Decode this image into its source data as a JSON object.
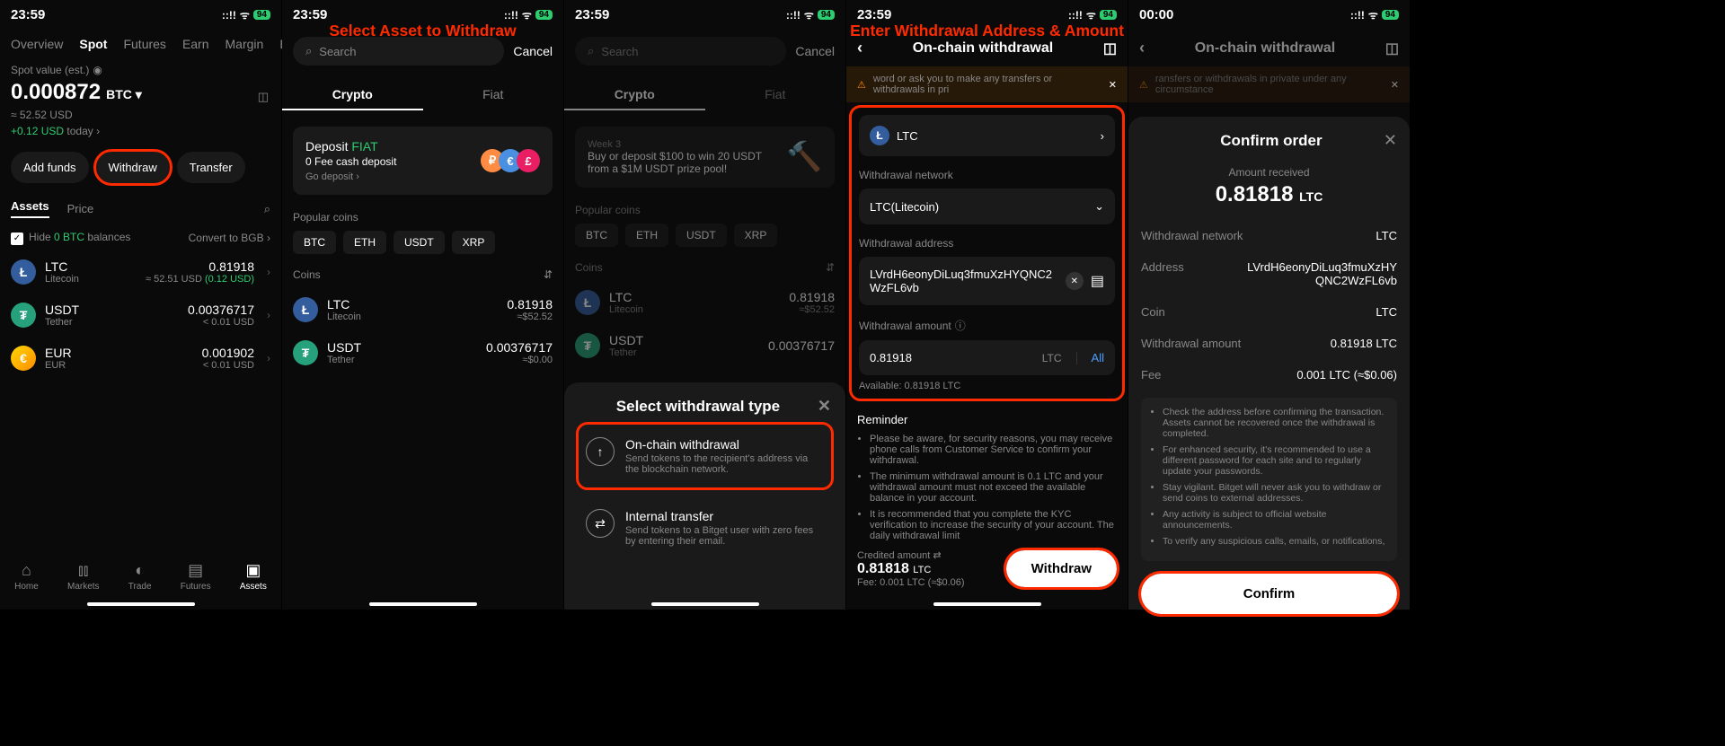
{
  "status": {
    "time1": "23:59",
    "time5": "00:00",
    "battery": "94"
  },
  "screen1": {
    "tabs": [
      "Overview",
      "Spot",
      "Futures",
      "Earn",
      "Margin",
      "Bots"
    ],
    "active_tab": "Spot",
    "spot_label": "Spot value (est.)",
    "spot_value": "0.000872",
    "spot_unit": "BTC ▾",
    "spot_approx": "≈ 52.52 USD",
    "spot_change": "+0.12 USD",
    "spot_change_suffix": " today",
    "add_funds": "Add funds",
    "withdraw": "Withdraw",
    "transfer": "Transfer",
    "assets_tab": "Assets",
    "price_tab": "Price",
    "hide_label": "Hide ",
    "hide_zero": "0 BTC",
    "hide_suffix": " balances",
    "convert": "Convert to BGB",
    "assets": [
      {
        "sym": "LTC",
        "name": "Litecoin",
        "amount": "0.81918",
        "usd": "≈ 52.51 USD",
        "change": "(0.12 USD)"
      },
      {
        "sym": "USDT",
        "name": "Tether",
        "amount": "0.00376717",
        "usd": "< 0.01 USD",
        "change": ""
      },
      {
        "sym": "EUR",
        "name": "EUR",
        "amount": "0.001902",
        "usd": "< 0.01 USD",
        "change": ""
      }
    ],
    "nav": [
      "Home",
      "Markets",
      "Trade",
      "Futures",
      "Assets"
    ]
  },
  "screen2": {
    "annotation": "Select Asset to Withdraw",
    "search_placeholder": "Search",
    "cancel": "Cancel",
    "crypto": "Crypto",
    "fiat": "Fiat",
    "deposit_title": "Deposit ",
    "deposit_fiat": "FIAT",
    "deposit_sub": "0 Fee cash deposit",
    "deposit_go": "Go deposit ›",
    "popular": "Popular coins",
    "popular_coins": [
      "BTC",
      "ETH",
      "USDT",
      "XRP"
    ],
    "coins_label": "Coins",
    "coins": [
      {
        "sym": "LTC",
        "name": "Litecoin",
        "amount": "0.81918",
        "usd": "≈$52.52"
      },
      {
        "sym": "USDT",
        "name": "Tether",
        "amount": "0.00376717",
        "usd": "≈$0.00"
      }
    ]
  },
  "screen3": {
    "search_placeholder": "Search",
    "cancel": "Cancel",
    "crypto": "Crypto",
    "fiat": "Fiat",
    "week_badge": "Week 3",
    "week_text": "Buy or deposit $100 to win 20 USDT from a $1M USDT prize pool!",
    "popular": "Popular coins",
    "popular_coins": [
      "BTC",
      "ETH",
      "USDT",
      "XRP"
    ],
    "coins_label": "Coins",
    "coins": [
      {
        "sym": "LTC",
        "name": "Litecoin",
        "amount": "0.81918",
        "usd": "≈$52.52"
      },
      {
        "sym": "USDT",
        "name": "Tether",
        "amount": "0.00376717",
        "usd": ""
      }
    ],
    "modal_title": "Select withdrawal type",
    "opt1_title": "On-chain withdrawal",
    "opt1_sub": "Send tokens to the recipient's address via the blockchain network.",
    "opt2_title": "Internal transfer",
    "opt2_sub": "Send tokens to a Bitget user with zero fees by entering their email."
  },
  "screen4": {
    "annotation": "Enter Withdrawal Address & Amount",
    "header": "On-chain withdrawal",
    "warning": "word or ask you to make any transfers or withdrawals in pri",
    "coin": "LTC",
    "net_label": "Withdrawal network",
    "net_value": "LTC(Litecoin)",
    "addr_label": "Withdrawal address",
    "addr_value": "LVrdH6eonyDiLuq3fmuXzHYQNC2WzFL6vb",
    "amt_label": "Withdrawal amount",
    "amt_value": "0.81918",
    "amt_unit": "LTC",
    "all": "All",
    "available": "Available: 0.81918 LTC",
    "reminder": "Reminder",
    "reminders": [
      "Please be aware, for security reasons, you may receive phone calls from Customer Service to confirm your withdrawal.",
      "The minimum withdrawal amount is 0.1 LTC and your withdrawal amount must not exceed the available balance in your account.",
      "It is recommended that you complete the KYC verification to increase the security of your account. The daily withdrawal limit"
    ],
    "credited_label": "Credited amount ⇄",
    "credited_amount": "0.81818",
    "credited_unit": "LTC",
    "fee_line": "Fee: 0.001 LTC (≈$0.06)",
    "withdraw_btn": "Withdraw"
  },
  "screen5": {
    "header": "On-chain withdrawal",
    "warning": "ransfers or withdrawals in private under any circumstance",
    "coin": "LTC",
    "modal_title": "Confirm order",
    "received_label": "Amount received",
    "received_amount": "0.81818",
    "received_unit": "LTC",
    "details": [
      {
        "label": "Withdrawal network",
        "value": "LTC"
      },
      {
        "label": "Address",
        "value": "LVrdH6eonyDiLuq3fmuXzHYQNC2WzFL6vb"
      },
      {
        "label": "Coin",
        "value": "LTC"
      },
      {
        "label": "Withdrawal amount",
        "value": "0.81918 LTC"
      },
      {
        "label": "Fee",
        "value": "0.001 LTC (≈$0.06)"
      }
    ],
    "warnings": [
      "Check the address before confirming the transaction. Assets cannot be recovered once the withdrawal is completed.",
      "For enhanced security, it's recommended to use a different password for each site and to regularly update your passwords.",
      "Stay vigilant. Bitget will never ask you to withdraw or send coins to external addresses.",
      "Any activity is subject to official website announcements.",
      "To verify any suspicious calls, emails, or notifications,"
    ],
    "confirm_btn": "Confirm"
  }
}
